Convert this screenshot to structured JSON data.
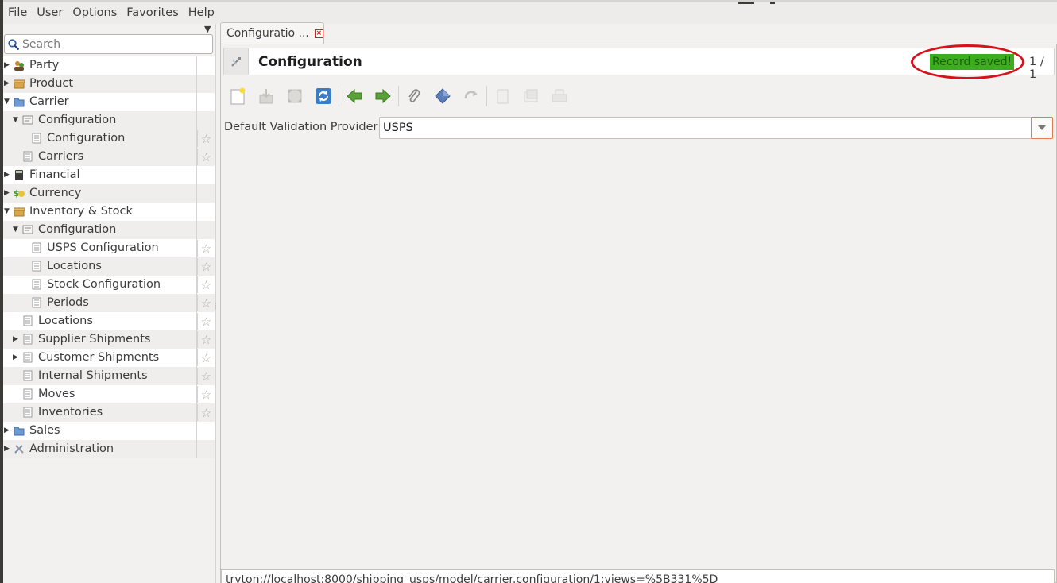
{
  "menubar": {
    "items": [
      "File",
      "User",
      "Options",
      "Favorites",
      "Help"
    ]
  },
  "sidebar": {
    "search_placeholder": "Search",
    "tree": [
      {
        "label": "Party",
        "level": 0,
        "expander": "collapsed",
        "icon": "party-icon"
      },
      {
        "label": "Product",
        "level": 0,
        "expander": "collapsed",
        "icon": "box-icon"
      },
      {
        "label": "Carrier",
        "level": 0,
        "expander": "expanded",
        "icon": "folder-icon"
      },
      {
        "label": "Configuration",
        "level": 1,
        "expander": "expanded",
        "icon": "config-icon"
      },
      {
        "label": "Configuration",
        "level": 2,
        "expander": "none",
        "icon": "list-icon",
        "star": true,
        "selected": true
      },
      {
        "label": "Carriers",
        "level": 1,
        "expander": "none",
        "icon": "list-icon",
        "star": true
      },
      {
        "label": "Financial",
        "level": 0,
        "expander": "collapsed",
        "icon": "calculator-icon"
      },
      {
        "label": "Currency",
        "level": 0,
        "expander": "collapsed",
        "icon": "currency-icon"
      },
      {
        "label": "Inventory & Stock",
        "level": 0,
        "expander": "expanded",
        "icon": "box-icon"
      },
      {
        "label": "Configuration",
        "level": 1,
        "expander": "expanded",
        "icon": "config-icon"
      },
      {
        "label": "USPS Configuration",
        "level": 2,
        "expander": "none",
        "icon": "list-icon",
        "star": true
      },
      {
        "label": "Locations",
        "level": 2,
        "expander": "none",
        "icon": "list-icon",
        "star": true
      },
      {
        "label": "Stock Configuration",
        "level": 2,
        "expander": "none",
        "icon": "list-icon",
        "star": true
      },
      {
        "label": "Periods",
        "level": 2,
        "expander": "none",
        "icon": "list-icon",
        "star": true
      },
      {
        "label": "Locations",
        "level": 1,
        "expander": "none",
        "icon": "list-icon",
        "star": true
      },
      {
        "label": "Supplier Shipments",
        "level": 1,
        "expander": "collapsed",
        "icon": "list-icon",
        "star": true
      },
      {
        "label": "Customer Shipments",
        "level": 1,
        "expander": "collapsed",
        "icon": "list-icon",
        "star": true
      },
      {
        "label": "Internal Shipments",
        "level": 1,
        "expander": "none",
        "icon": "list-icon",
        "star": true
      },
      {
        "label": "Moves",
        "level": 1,
        "expander": "none",
        "icon": "list-icon",
        "star": true
      },
      {
        "label": "Inventories",
        "level": 1,
        "expander": "none",
        "icon": "list-icon",
        "star": true
      },
      {
        "label": "Sales",
        "level": 0,
        "expander": "collapsed",
        "icon": "folder-icon"
      },
      {
        "label": "Administration",
        "level": 0,
        "expander": "collapsed",
        "icon": "tools-icon"
      }
    ]
  },
  "tab": {
    "label": "Configuratio ..."
  },
  "header": {
    "title": "Configuration",
    "status_text": "Record saved!",
    "record_count": "1 / 1"
  },
  "toolbar": {
    "buttons": [
      "new-icon",
      "save-icon",
      "switch-view-icon",
      "reload-icon",
      "previous-icon",
      "next-icon",
      "attachment-icon",
      "action-icon",
      "relate-icon",
      "report-icon",
      "email-icon",
      "print-icon"
    ]
  },
  "form": {
    "default_validation_provider_label": "Default Validation Provider:",
    "default_validation_provider_value": "USPS"
  },
  "statusbar": {
    "url": "tryton://localhost:8000/shipping_usps/model/carrier.configuration/1;views=%5B331%5D"
  },
  "colors": {
    "status_badge": "#3cad1e",
    "highlight_ring": "#d8121a"
  }
}
